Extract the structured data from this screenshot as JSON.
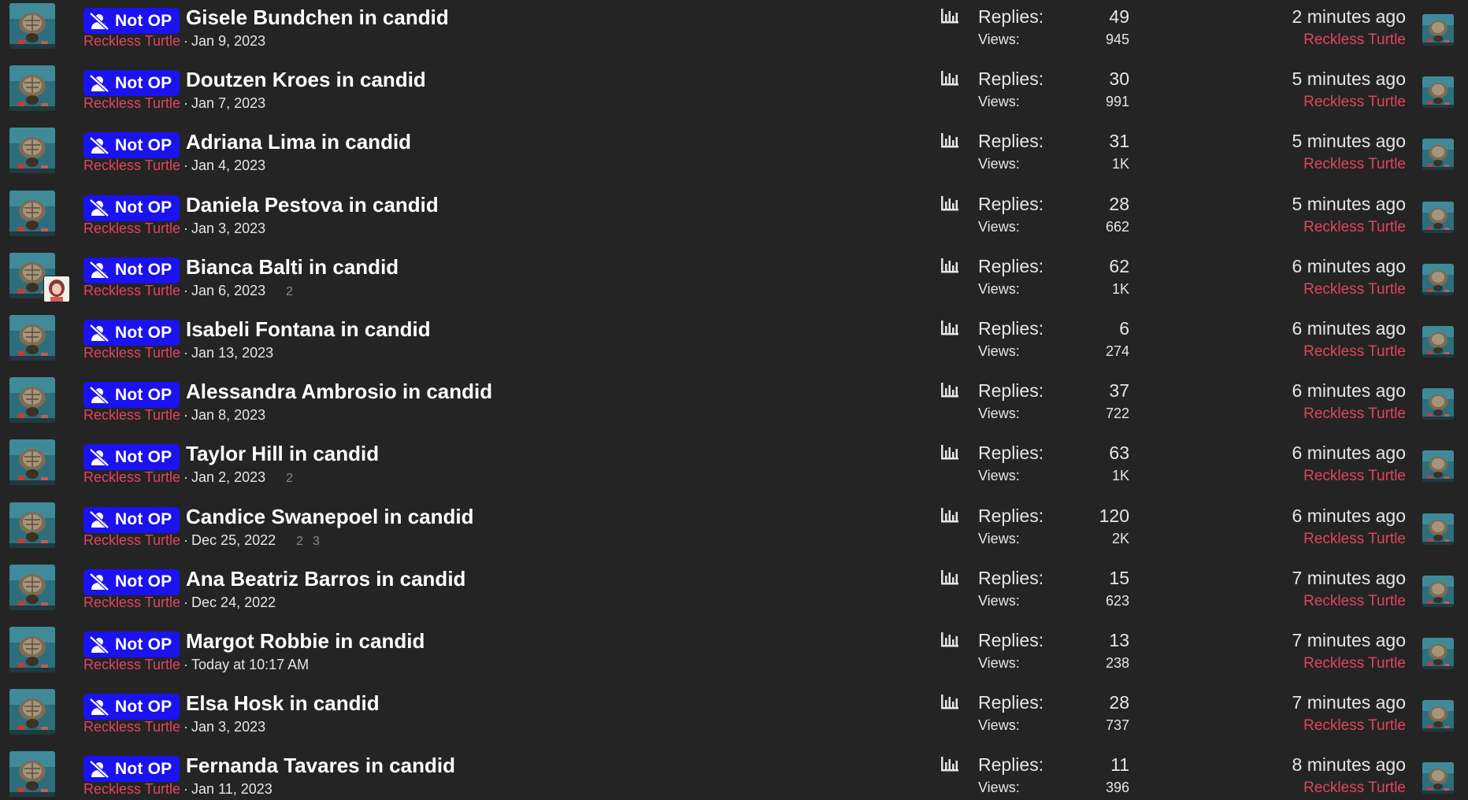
{
  "badge_label": "Not OP",
  "replies_label": "Replies:",
  "views_label": "Views:",
  "colors": {
    "background": "#242424",
    "badge": "#1a12f0",
    "author": "#e0455f",
    "text": "#e6e6e6"
  },
  "icons": {
    "badge": "user-slash-icon",
    "stats": "bar-chart-icon"
  },
  "threads": [
    {
      "title": "Gisele Bundchen in candid",
      "author": "Reckless Turtle",
      "date": "Jan 9, 2023",
      "pages": [],
      "replies": "49",
      "views": "945",
      "last_time": "2 minutes ago",
      "last_user": "Reckless Turtle",
      "extra_avatar": false
    },
    {
      "title": "Doutzen Kroes in candid",
      "author": "Reckless Turtle",
      "date": "Jan 7, 2023",
      "pages": [],
      "replies": "30",
      "views": "991",
      "last_time": "5 minutes ago",
      "last_user": "Reckless Turtle",
      "extra_avatar": false
    },
    {
      "title": "Adriana Lima in candid",
      "author": "Reckless Turtle",
      "date": "Jan 4, 2023",
      "pages": [],
      "replies": "31",
      "views": "1K",
      "last_time": "5 minutes ago",
      "last_user": "Reckless Turtle",
      "extra_avatar": false
    },
    {
      "title": "Daniela Pestova in candid",
      "author": "Reckless Turtle",
      "date": "Jan 3, 2023",
      "pages": [],
      "replies": "28",
      "views": "662",
      "last_time": "5 minutes ago",
      "last_user": "Reckless Turtle",
      "extra_avatar": false
    },
    {
      "title": "Bianca Balti in candid",
      "author": "Reckless Turtle",
      "date": "Jan 6, 2023",
      "pages": [
        "2"
      ],
      "replies": "62",
      "views": "1K",
      "last_time": "6 minutes ago",
      "last_user": "Reckless Turtle",
      "extra_avatar": true
    },
    {
      "title": "Isabeli Fontana in candid",
      "author": "Reckless Turtle",
      "date": "Jan 13, 2023",
      "pages": [],
      "replies": "6",
      "views": "274",
      "last_time": "6 minutes ago",
      "last_user": "Reckless Turtle",
      "extra_avatar": false
    },
    {
      "title": "Alessandra Ambrosio in candid",
      "author": "Reckless Turtle",
      "date": "Jan 8, 2023",
      "pages": [],
      "replies": "37",
      "views": "722",
      "last_time": "6 minutes ago",
      "last_user": "Reckless Turtle",
      "extra_avatar": false
    },
    {
      "title": "Taylor Hill in candid",
      "author": "Reckless Turtle",
      "date": "Jan 2, 2023",
      "pages": [
        "2"
      ],
      "replies": "63",
      "views": "1K",
      "last_time": "6 minutes ago",
      "last_user": "Reckless Turtle",
      "extra_avatar": false
    },
    {
      "title": "Candice Swanepoel in candid",
      "author": "Reckless Turtle",
      "date": "Dec 25, 2022",
      "pages": [
        "2",
        "3"
      ],
      "replies": "120",
      "views": "2K",
      "last_time": "6 minutes ago",
      "last_user": "Reckless Turtle",
      "extra_avatar": false
    },
    {
      "title": "Ana Beatriz Barros in candid",
      "author": "Reckless Turtle",
      "date": "Dec 24, 2022",
      "pages": [],
      "replies": "15",
      "views": "623",
      "last_time": "7 minutes ago",
      "last_user": "Reckless Turtle",
      "extra_avatar": false
    },
    {
      "title": "Margot Robbie in candid",
      "author": "Reckless Turtle",
      "date": "Today at 10:17 AM",
      "pages": [],
      "replies": "13",
      "views": "238",
      "last_time": "7 minutes ago",
      "last_user": "Reckless Turtle",
      "extra_avatar": false
    },
    {
      "title": "Elsa Hosk in candid",
      "author": "Reckless Turtle",
      "date": "Jan 3, 2023",
      "pages": [],
      "replies": "28",
      "views": "737",
      "last_time": "7 minutes ago",
      "last_user": "Reckless Turtle",
      "extra_avatar": false
    },
    {
      "title": "Fernanda Tavares in candid",
      "author": "Reckless Turtle",
      "date": "Jan 11, 2023",
      "pages": [],
      "replies": "11",
      "views": "396",
      "last_time": "8 minutes ago",
      "last_user": "Reckless Turtle",
      "extra_avatar": false
    }
  ]
}
